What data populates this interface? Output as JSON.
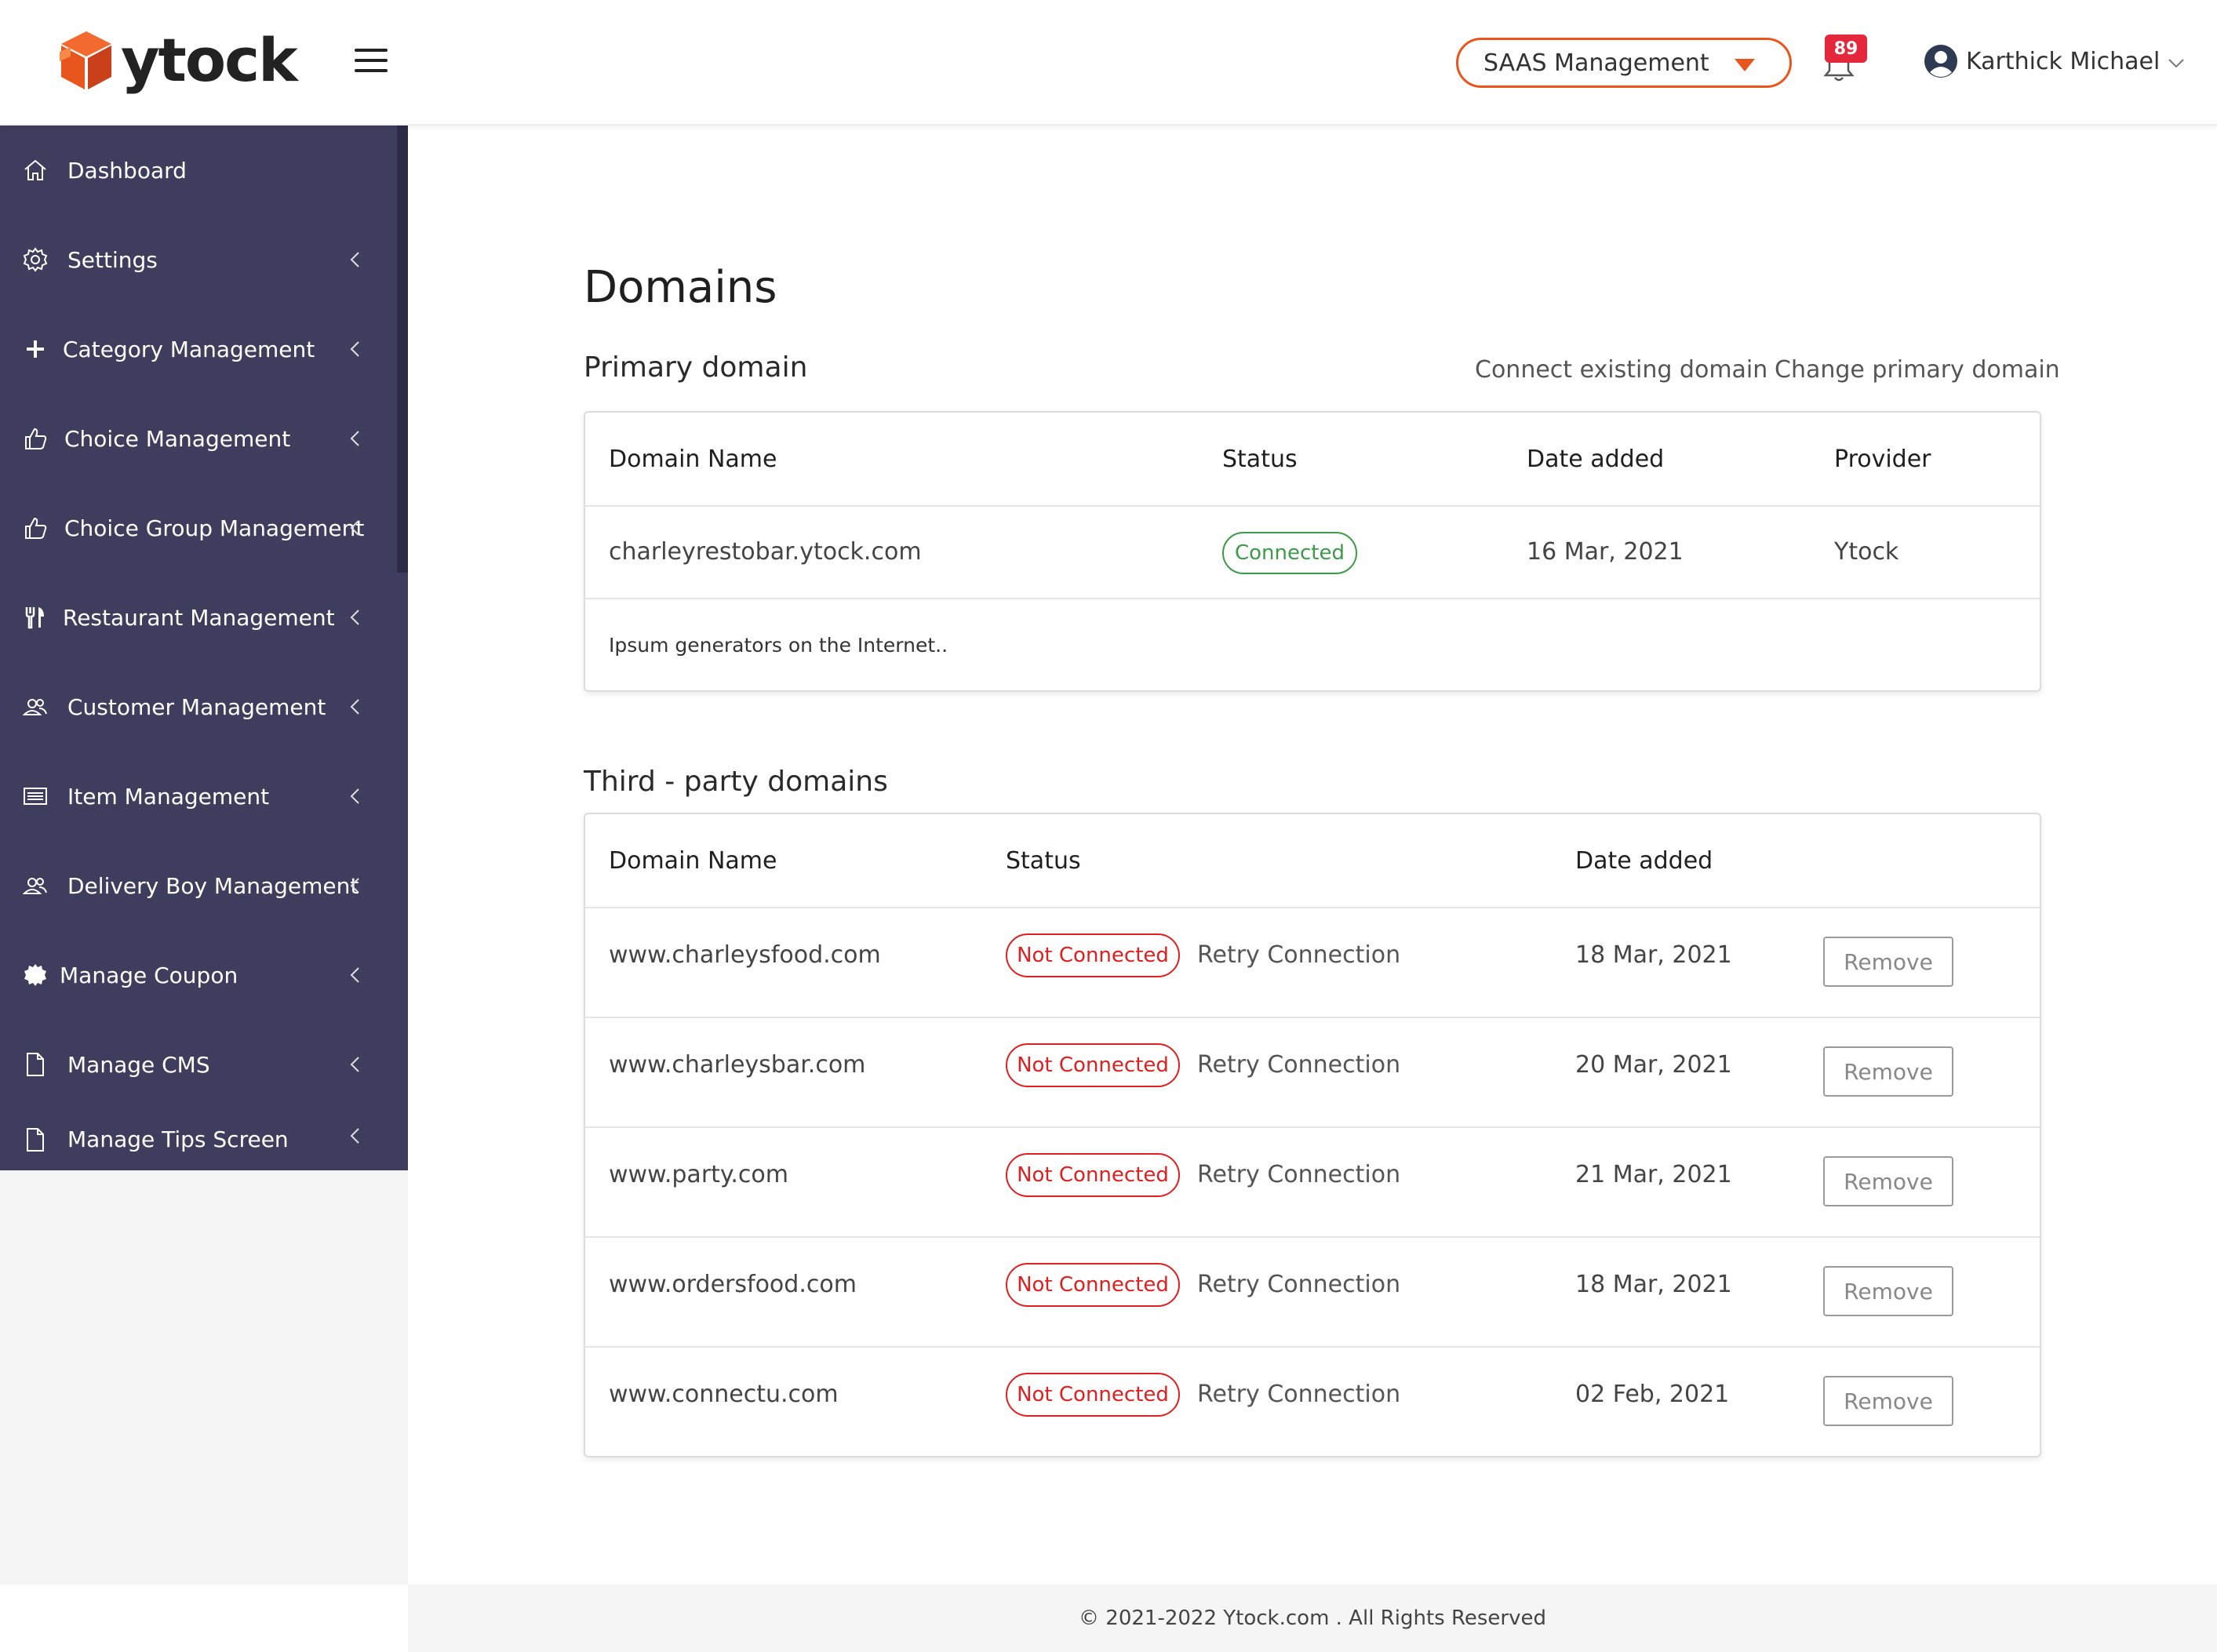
{
  "header": {
    "brand": "ytock",
    "brand_accent_color": "#e8561e",
    "workspace_select": "SAAS Management",
    "notification_count": "89",
    "user_name": "Karthick Michael"
  },
  "sidebar": {
    "background_color": "#3f3d5e",
    "items": [
      {
        "label": "Dashboard",
        "icon": "home-icon"
      },
      {
        "label": "Settings",
        "icon": "gear-icon"
      },
      {
        "label": "Category Management",
        "icon": "plus-icon"
      },
      {
        "label": "Choice Management",
        "icon": "thumbs-up-icon"
      },
      {
        "label": "Choice Group Management",
        "icon": "thumbs-up-icon"
      },
      {
        "label": "Restaurant Management",
        "icon": "utensils-icon"
      },
      {
        "label": "Customer Management",
        "icon": "users-icon"
      },
      {
        "label": "Item Management",
        "icon": "list-icon"
      },
      {
        "label": "Delivery Boy Management",
        "icon": "users-icon"
      },
      {
        "label": "Manage Coupon",
        "icon": "coupon-icon"
      },
      {
        "label": "Manage CMS",
        "icon": "file-icon"
      },
      {
        "label": "Manage Tips Screen",
        "icon": "file-icon"
      }
    ]
  },
  "main": {
    "title": "Domains",
    "primary": {
      "title": "Primary domain",
      "connect_link": "Connect existing domain",
      "change_link": "Change primary domain",
      "headers": {
        "name": "Domain Name",
        "status": "Status",
        "date": "Date added",
        "provider": "Provider"
      },
      "row": {
        "name": "charleyrestobar.ytock.com",
        "status": "Connected",
        "date": "16 Mar, 2021",
        "provider": "Ytock"
      },
      "note": "Ipsum generators on the Internet.."
    },
    "third_party": {
      "title": "Third - party domains",
      "headers": {
        "name": "Domain Name",
        "status": "Status",
        "date": "Date added"
      },
      "rows": [
        {
          "name": "www.charleysfood.com",
          "status": "Not Connected",
          "retry": "Retry Connection",
          "date": "18 Mar, 2021",
          "action": "Remove"
        },
        {
          "name": "www.charleysbar.com",
          "status": "Not Connected",
          "retry": "Retry Connection",
          "date": "20 Mar, 2021",
          "action": "Remove"
        },
        {
          "name": "www.party.com",
          "status": "Not Connected",
          "retry": "Retry Connection",
          "date": "21 Mar, 2021",
          "action": "Remove"
        },
        {
          "name": "www.ordersfood.com",
          "status": "Not Connected",
          "retry": "Retry Connection",
          "date": "18 Mar, 2021",
          "action": "Remove"
        },
        {
          "name": "www.connectu.com",
          "status": "Not Connected",
          "retry": "Retry Connection",
          "date": "02 Feb, 2021",
          "action": "Remove"
        }
      ]
    }
  },
  "footer": {
    "text": "© 2021-2022 Ytock.com . All Rights Reserved"
  }
}
